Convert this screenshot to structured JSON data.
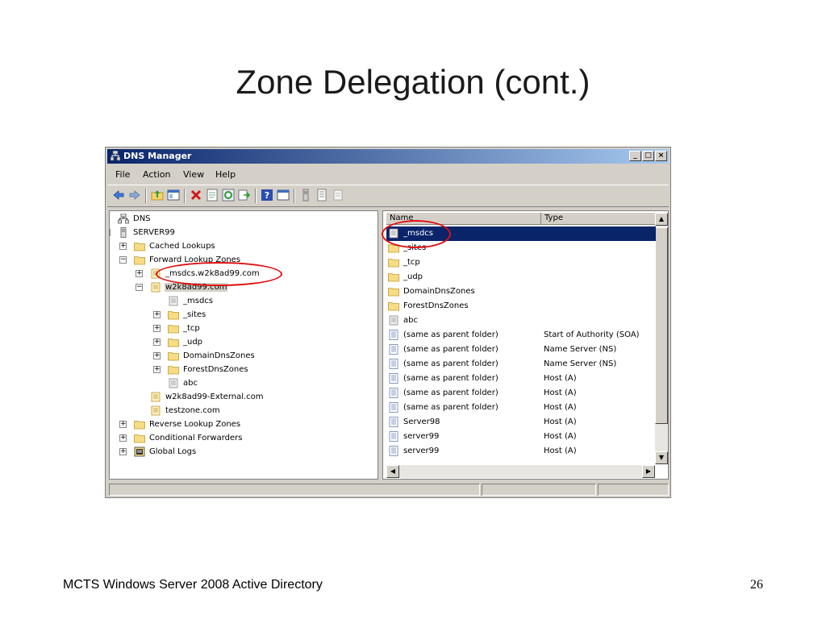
{
  "slide": {
    "title": "Zone Delegation (cont.)",
    "footer": "MCTS Windows Server 2008 Active Directory",
    "page_number": "26"
  },
  "window": {
    "title": "DNS Manager",
    "controls": [
      "_",
      "□",
      "×"
    ]
  },
  "menu": [
    "File",
    "Action",
    "View",
    "Help"
  ],
  "toolbar_icons": [
    "back-icon",
    "forward-icon",
    "up-folder-icon",
    "show-hide-tree-icon",
    "delete-icon",
    "properties-icon",
    "refresh-icon",
    "export-icon",
    "help-icon",
    "console-icon",
    "server-icon",
    "list-icon",
    "zone-icon"
  ],
  "tree": {
    "items": [
      {
        "label": "DNS",
        "icon": "dns-icon",
        "expander": ""
      },
      {
        "label": "SERVER99",
        "icon": "server-icon",
        "expander": "−"
      },
      {
        "label": "Cached Lookups",
        "icon": "folder-icon",
        "expander": "+"
      },
      {
        "label": "Forward Lookup Zones",
        "icon": "folder-icon",
        "expander": "−"
      },
      {
        "label": "_msdcs.w2k8ad99.com",
        "icon": "zone-icon",
        "expander": "+"
      },
      {
        "label": "w2k8ad99.com",
        "icon": "zone-icon",
        "expander": "−"
      },
      {
        "label": "_msdcs",
        "icon": "delegated-zone-icon",
        "expander": ""
      },
      {
        "label": "_sites",
        "icon": "folder-icon",
        "expander": "+"
      },
      {
        "label": "_tcp",
        "icon": "folder-icon",
        "expander": "+"
      },
      {
        "label": "_udp",
        "icon": "folder-icon",
        "expander": "+"
      },
      {
        "label": "DomainDnsZones",
        "icon": "folder-icon",
        "expander": "+"
      },
      {
        "label": "ForestDnsZones",
        "icon": "folder-icon",
        "expander": "+"
      },
      {
        "label": "abc",
        "icon": "delegated-zone-icon",
        "expander": ""
      },
      {
        "label": "w2k8ad99-External.com",
        "icon": "zone-icon",
        "expander": ""
      },
      {
        "label": "testzone.com",
        "icon": "zone-icon",
        "expander": ""
      },
      {
        "label": "Reverse Lookup Zones",
        "icon": "folder-icon",
        "expander": "+"
      },
      {
        "label": "Conditional Forwarders",
        "icon": "folder-icon",
        "expander": "+"
      },
      {
        "label": "Global Logs",
        "icon": "logs-icon",
        "expander": "+"
      }
    ]
  },
  "list": {
    "columns": [
      "Name",
      "Type"
    ],
    "rows": [
      {
        "name": "_msdcs",
        "type": "",
        "icon": "delegated-zone-icon"
      },
      {
        "name": "_sites",
        "type": "",
        "icon": "folder-icon"
      },
      {
        "name": "_tcp",
        "type": "",
        "icon": "folder-icon"
      },
      {
        "name": "_udp",
        "type": "",
        "icon": "folder-icon"
      },
      {
        "name": "DomainDnsZones",
        "type": "",
        "icon": "folder-icon"
      },
      {
        "name": "ForestDnsZones",
        "type": "",
        "icon": "folder-icon"
      },
      {
        "name": "abc",
        "type": "",
        "icon": "delegated-zone-icon"
      },
      {
        "name": "(same as parent folder)",
        "type": "Start of Authority (SOA)",
        "icon": "record-icon"
      },
      {
        "name": "(same as parent folder)",
        "type": "Name Server (NS)",
        "icon": "record-icon"
      },
      {
        "name": "(same as parent folder)",
        "type": "Name Server (NS)",
        "icon": "record-icon"
      },
      {
        "name": "(same as parent folder)",
        "type": "Host (A)",
        "icon": "record-icon"
      },
      {
        "name": "(same as parent folder)",
        "type": "Host (A)",
        "icon": "record-icon"
      },
      {
        "name": "(same as parent folder)",
        "type": "Host (A)",
        "icon": "record-icon"
      },
      {
        "name": "Server98",
        "type": "Host (A)",
        "icon": "record-icon"
      },
      {
        "name": "server99",
        "type": "Host (A)",
        "icon": "record-icon"
      },
      {
        "name": "server99",
        "type": "Host (A)",
        "icon": "record-icon"
      }
    ]
  },
  "colors": {
    "selection": "#0a246a",
    "annotation": "#e01010",
    "window_face": "#d4d0c8"
  }
}
